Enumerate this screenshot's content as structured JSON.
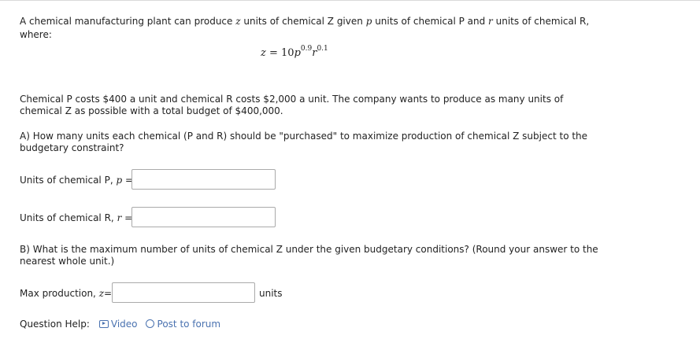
{
  "intro": {
    "line1_a": "A chemical manufacturing plant can produce ",
    "line1_var_z": "z",
    "line1_b": " units of chemical Z given ",
    "line1_var_p": "p",
    "line1_c": " units of chemical P and ",
    "line1_var_r": "r",
    "line1_d": " units of chemical R,",
    "line2": "where:"
  },
  "formula": {
    "lhs": "z",
    "eq": " = 10",
    "p": "p",
    "p_exp": "0.9",
    "r": "r",
    "r_exp": "0.1"
  },
  "costs": {
    "line1": "Chemical P costs $400 a unit and chemical R costs $2,000 a unit. The company wants to produce as many units of",
    "line2": "chemical Z as possible with a total budget of $400,000."
  },
  "part_a": {
    "line1": "A) How many units each chemical (P and R) should be \"purchased\" to maximize production of chemical Z subject to the",
    "line2": "budgetary constraint?"
  },
  "field_p": {
    "label": "Units of chemical P, ",
    "var": "p",
    "eq": " =",
    "value": ""
  },
  "field_r": {
    "label": "Units of chemical R, ",
    "var": "r",
    "eq": " =",
    "value": ""
  },
  "part_b": {
    "line1": "B) What is the maximum number of units of chemical Z under the given budgetary conditions? (Round your answer to the",
    "line2": "nearest whole unit.)"
  },
  "field_z": {
    "label": "Max production, ",
    "var": "z",
    "eq": "=",
    "value": "",
    "unit": "units"
  },
  "help": {
    "label": "Question Help:",
    "video": "Video",
    "video_icon": "video-icon",
    "forum": "Post to forum",
    "forum_icon": "speech-bubble-icon"
  }
}
